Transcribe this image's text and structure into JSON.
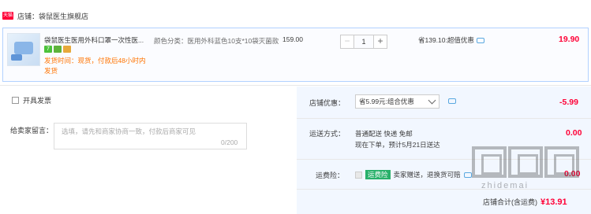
{
  "store": {
    "badge": "天猫",
    "label": "店铺：袋鼠医生旗舰店"
  },
  "item": {
    "title": "袋鼠医生医用外科口罩一次性医...",
    "badge_text": "7",
    "shipping": "发货时间：现货，付款后48小时内发货",
    "sku": "颜色分类：医用外科蓝色10支*10袋灭菌款",
    "price": "159.00",
    "quantity": "1",
    "minus": "−",
    "plus": "+",
    "saving": "省139.10:超值优惠",
    "subtotal": "19.90"
  },
  "invoice": {
    "label": "开具发票"
  },
  "message": {
    "label": "给卖家留言：",
    "placeholder": "选填，请先和商家协商一致，付款后商家可见",
    "count": "0/200"
  },
  "coupon": {
    "label": "店铺优惠：",
    "selected": "省5.99元:组合优惠",
    "amount": "-5.99"
  },
  "delivery": {
    "label": "运送方式：",
    "line1": "普通配送 快递 免邮",
    "line2": "现在下单，预计5月21日送达",
    "fee": "0.00"
  },
  "insurance": {
    "label": "运费险：",
    "tag": "运费险",
    "text": "卖家赠送，退换货可赔",
    "fee": "0.00"
  },
  "total": {
    "label": "店铺合计(含运费)",
    "value": "¥13.91"
  },
  "watermark": {
    "sub": "zhidemai"
  }
}
